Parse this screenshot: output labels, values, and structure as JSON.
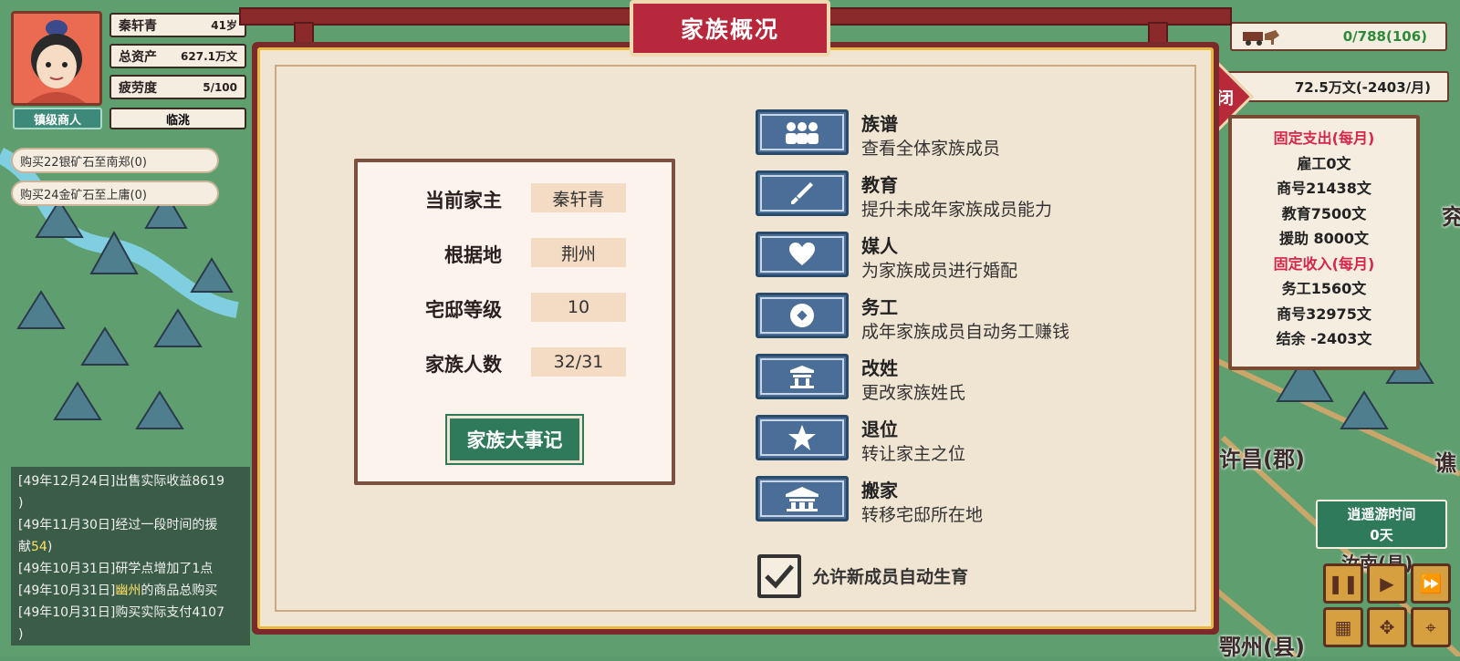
{
  "player": {
    "name": "秦轩青",
    "age": "41岁",
    "assets_label": "总资产",
    "assets_value": "627.1万文",
    "fatigue_label": "疲劳度",
    "fatigue_value": "5/100",
    "rank": "镇级商人",
    "location": "临洮"
  },
  "tasks": [
    "购买22银矿石至南郑(0)",
    "购买24金矿石至上庸(0)"
  ],
  "log": [
    {
      "t": "[49年12月24日]出售实际收益8619"
    },
    {
      "t": ")"
    },
    {
      "t": "[49年11月30日]经过一段时间的援"
    },
    {
      "t": "献",
      "hl": "54",
      "t2": ")"
    },
    {
      "t": "[49年10月31日]研学点增加了1点"
    },
    {
      "t": "[49年10月31日]",
      "hl": "幽州",
      "t2": "的商品总购买"
    },
    {
      "t": "[49年10月31日]购买实际支付4107"
    },
    {
      "t": ")"
    }
  ],
  "hud": {
    "cargo": "0/788(106)",
    "money": "72.5万文(-2403/月)",
    "close_label": "关闭"
  },
  "budget": {
    "expense_title": "固定支出(每月)",
    "expenses": [
      "雇工0文",
      "商号21438文",
      "教育7500文",
      "援助 8000文"
    ],
    "income_title": "固定收入(每月)",
    "incomes": [
      "务工1560文",
      "商号32975文",
      "结余  -2403文"
    ]
  },
  "time": {
    "label": "逍遥游时间",
    "value": "0天"
  },
  "cities": [
    "许昌(郡)",
    "谯",
    "汝南(县)",
    "鄂州(县)",
    "兖"
  ],
  "dialog": {
    "title": "家族概况",
    "fields": [
      {
        "label": "当前家主",
        "value": "秦轩青"
      },
      {
        "label": "根据地",
        "value": "荆州"
      },
      {
        "label": "宅邸等级",
        "value": "10"
      },
      {
        "label": "家族人数",
        "value": "32/31"
      }
    ],
    "events_button": "家族大事记",
    "options": [
      {
        "title": "族谱",
        "desc": "查看全体家族成员",
        "icon": "family-icon"
      },
      {
        "title": "教育",
        "desc": "提升未成年家族成员能力",
        "icon": "brush-icon"
      },
      {
        "title": "媒人",
        "desc": "为家族成员进行婚配",
        "icon": "heart-icon"
      },
      {
        "title": "务工",
        "desc": "成年家族成员自动务工赚钱",
        "icon": "coin-icon"
      },
      {
        "title": "改姓",
        "desc": "更改家族姓氏",
        "icon": "shrine-icon"
      },
      {
        "title": "退位",
        "desc": "转让家主之位",
        "icon": "star-icon"
      },
      {
        "title": "搬家",
        "desc": "转移宅邸所在地",
        "icon": "house-icon"
      }
    ],
    "auto_birth_label": "允许新成员自动生育",
    "auto_birth_checked": true
  }
}
